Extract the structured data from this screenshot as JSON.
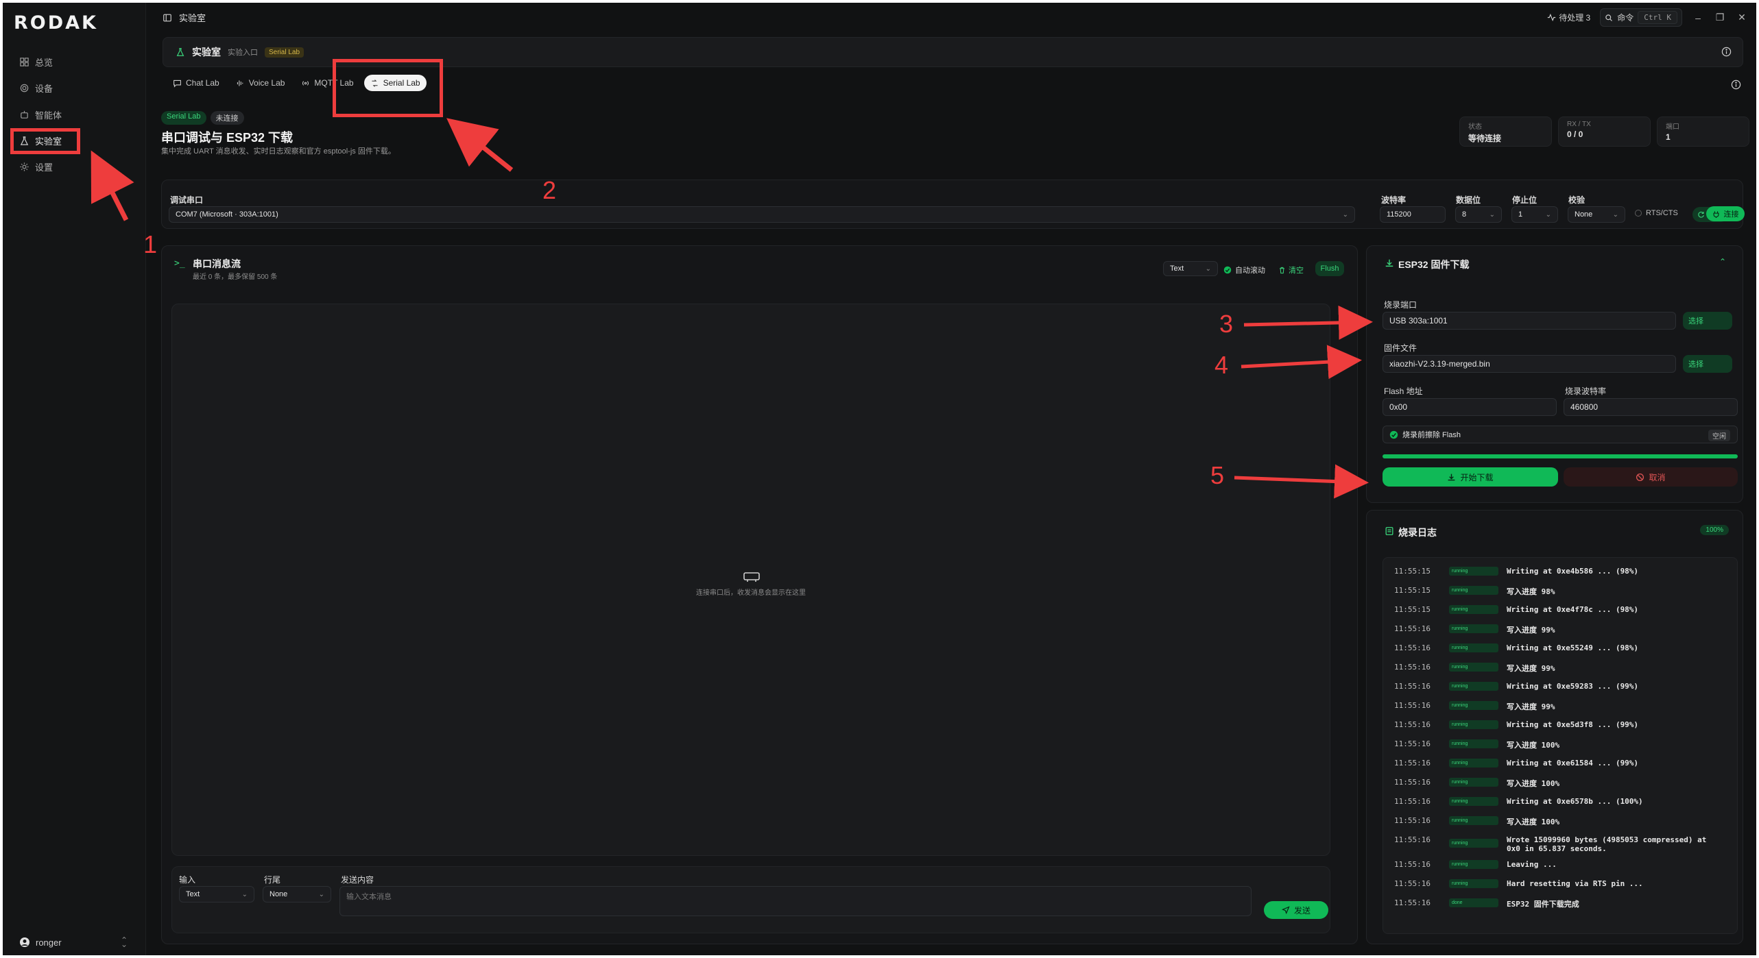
{
  "app": {
    "logo": "RODAK",
    "window_title": "实验室"
  },
  "sidebar": {
    "items": [
      {
        "label": "总览",
        "icon": "dashboard-icon"
      },
      {
        "label": "设备",
        "icon": "gear-icon"
      },
      {
        "label": "智能体",
        "icon": "robot-icon"
      },
      {
        "label": "实验室",
        "icon": "flask-icon",
        "active": true
      },
      {
        "label": "设置",
        "icon": "settings-icon"
      }
    ],
    "user": "ronger"
  },
  "topbar": {
    "pending": "待处理 3",
    "search": "命令",
    "shortcut": "Ctrl K"
  },
  "header": {
    "title": "实验室",
    "subtitle": "实验入口",
    "badge": "Serial Lab"
  },
  "tabs": [
    {
      "label": "Chat Lab",
      "icon": "chat-icon"
    },
    {
      "label": "Voice Lab",
      "icon": "voice-icon"
    },
    {
      "label": "MQTT Lab",
      "icon": "broadcast-icon"
    },
    {
      "label": "Serial Lab",
      "icon": "serial-icon",
      "active": true
    }
  ],
  "page": {
    "badge_primary": "Serial Lab",
    "badge_secondary": "未连接",
    "title": "串口调试与 ESP32 下载",
    "description": "集中完成 UART 消息收发、实时日志观察和官方 esptool-js 固件下载。"
  },
  "stats": [
    {
      "label": "状态",
      "value": "等待连接"
    },
    {
      "label": "RX / TX",
      "value": "0 / 0"
    },
    {
      "label": "端口",
      "value": "1"
    }
  ],
  "serial_config": {
    "port_label": "调试串口",
    "port_value": "COM7 (Microsoft · 303A:1001)",
    "baud_label": "波特率",
    "baud_value": "115200",
    "databits_label": "数据位",
    "databits_value": "8",
    "stopbits_label": "停止位",
    "stopbits_value": "1",
    "parity_label": "校验",
    "parity_value": "None",
    "rtscts_label": "RTS/CTS",
    "refresh_label": "刷新",
    "connect_label": "连接"
  },
  "message_stream": {
    "title": "串口消息流",
    "subtitle": "最近 0 条，最多保留 500 条",
    "format": "Text",
    "autoscroll": "自动滚动",
    "clear": "清空",
    "flush": "Flush",
    "empty_hint": "连接串口后，收发消息会显示在这里"
  },
  "send": {
    "input_label": "输入",
    "input_value": "Text",
    "eol_label": "行尾",
    "eol_value": "None",
    "content_label": "发送内容",
    "content_placeholder": "输入文本消息",
    "send_label": "发送"
  },
  "esp32": {
    "title": "ESP32 固件下载",
    "burn_port_label": "烧录端口",
    "burn_port_value": "USB 303a:1001",
    "select_label": "选择",
    "firmware_label": "固件文件",
    "firmware_value": "xiaozhi-V2.3.19-merged.bin",
    "flash_addr_label": "Flash 地址",
    "flash_addr_value": "0x00",
    "burn_baud_label": "烧录波特率",
    "burn_baud_value": "460800",
    "erase_label": "烧录前擦除 Flash",
    "idle_label": "空闲",
    "progress": 100,
    "start_label": "开始下载",
    "cancel_label": "取消"
  },
  "burn_log": {
    "title": "烧录日志",
    "percent": "100%",
    "rows": [
      {
        "time": "11:55:15",
        "level": "running",
        "msg": "Writing at 0xe4b586 ... (98%)"
      },
      {
        "time": "11:55:15",
        "level": "running",
        "msg": "写入进度 98%"
      },
      {
        "time": "11:55:15",
        "level": "running",
        "msg": "Writing at 0xe4f78c ... (98%)"
      },
      {
        "time": "11:55:16",
        "level": "running",
        "msg": "写入进度 99%"
      },
      {
        "time": "11:55:16",
        "level": "running",
        "msg": "Writing at 0xe55249 ... (98%)"
      },
      {
        "time": "11:55:16",
        "level": "running",
        "msg": "写入进度 99%"
      },
      {
        "time": "11:55:16",
        "level": "running",
        "msg": "Writing at 0xe59283 ... (99%)"
      },
      {
        "time": "11:55:16",
        "level": "running",
        "msg": "写入进度 99%"
      },
      {
        "time": "11:55:16",
        "level": "running",
        "msg": "Writing at 0xe5d3f8 ... (99%)"
      },
      {
        "time": "11:55:16",
        "level": "running",
        "msg": "写入进度 100%"
      },
      {
        "time": "11:55:16",
        "level": "running",
        "msg": "Writing at 0xe61584 ... (99%)"
      },
      {
        "time": "11:55:16",
        "level": "running",
        "msg": "写入进度 100%"
      },
      {
        "time": "11:55:16",
        "level": "running",
        "msg": "Writing at 0xe6578b ... (100%)"
      },
      {
        "time": "11:55:16",
        "level": "running",
        "msg": "写入进度 100%"
      },
      {
        "time": "11:55:16",
        "level": "running",
        "msg": "Wrote 15099960 bytes (4985053 compressed) at 0x0 in 65.837 seconds.",
        "tall": true
      },
      {
        "time": "11:55:16",
        "level": "running",
        "msg": "Leaving ..."
      },
      {
        "time": "11:55:16",
        "level": "running",
        "msg": "Hard resetting via RTS pin ..."
      },
      {
        "time": "11:55:16",
        "level": "done",
        "msg": "ESP32 固件下载完成"
      }
    ]
  },
  "annotations": [
    "1",
    "2",
    "3",
    "4",
    "5"
  ]
}
